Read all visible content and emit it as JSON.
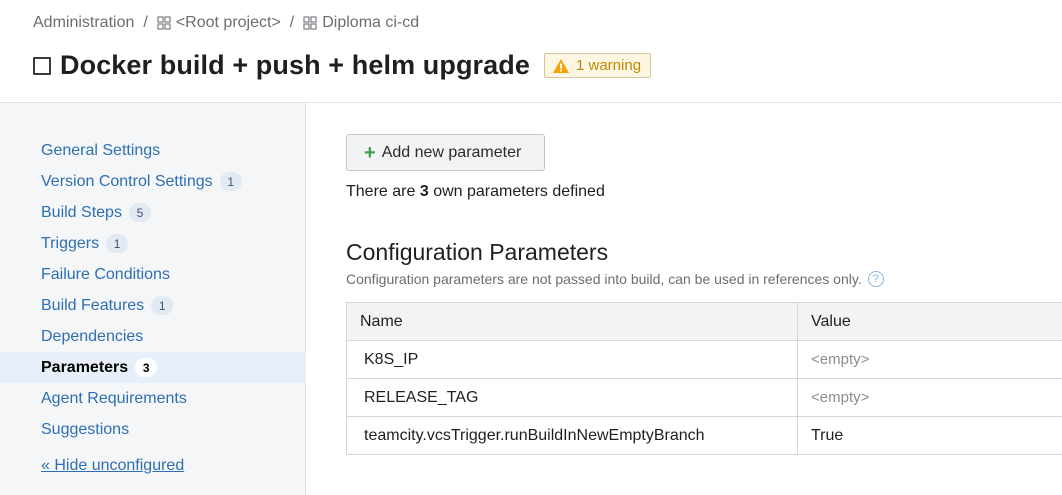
{
  "breadcrumb": {
    "root": "Administration",
    "sep": "/",
    "project": "<Root project>",
    "subproject": "Diploma ci-cd"
  },
  "header": {
    "title": "Docker build + push + helm upgrade",
    "warning": "1 warning"
  },
  "sidebar": {
    "items": [
      {
        "label": "General Settings",
        "count": null
      },
      {
        "label": "Version Control Settings",
        "count": "1"
      },
      {
        "label": "Build Steps",
        "count": "5"
      },
      {
        "label": "Triggers",
        "count": "1"
      },
      {
        "label": "Failure Conditions",
        "count": null
      },
      {
        "label": "Build Features",
        "count": "1"
      },
      {
        "label": "Dependencies",
        "count": null
      },
      {
        "label": "Parameters",
        "count": "3",
        "active": true
      },
      {
        "label": "Agent Requirements",
        "count": null
      },
      {
        "label": "Suggestions",
        "count": null
      }
    ],
    "hide_link": "« Hide unconfigured"
  },
  "main": {
    "add_button": "Add new parameter",
    "count_prefix": "There are",
    "count_value": "3",
    "count_suffix": "own parameters defined",
    "section_title": "Configuration Parameters",
    "section_desc": "Configuration parameters are not passed into build, can be used in references only.",
    "table": {
      "headers": [
        "Name",
        "Value"
      ],
      "rows": [
        {
          "name": "K8S_IP",
          "value": "<empty>",
          "empty": true
        },
        {
          "name": "RELEASE_TAG",
          "value": "<empty>",
          "empty": true
        },
        {
          "name": "teamcity.vcsTrigger.runBuildInNewEmptyBranch",
          "value": "True",
          "empty": false
        }
      ]
    }
  },
  "colors": {
    "link": "#2f6fb1",
    "warning": "#c08a00",
    "active_bg": "#e7f0fa",
    "plus": "#3ea04a"
  }
}
